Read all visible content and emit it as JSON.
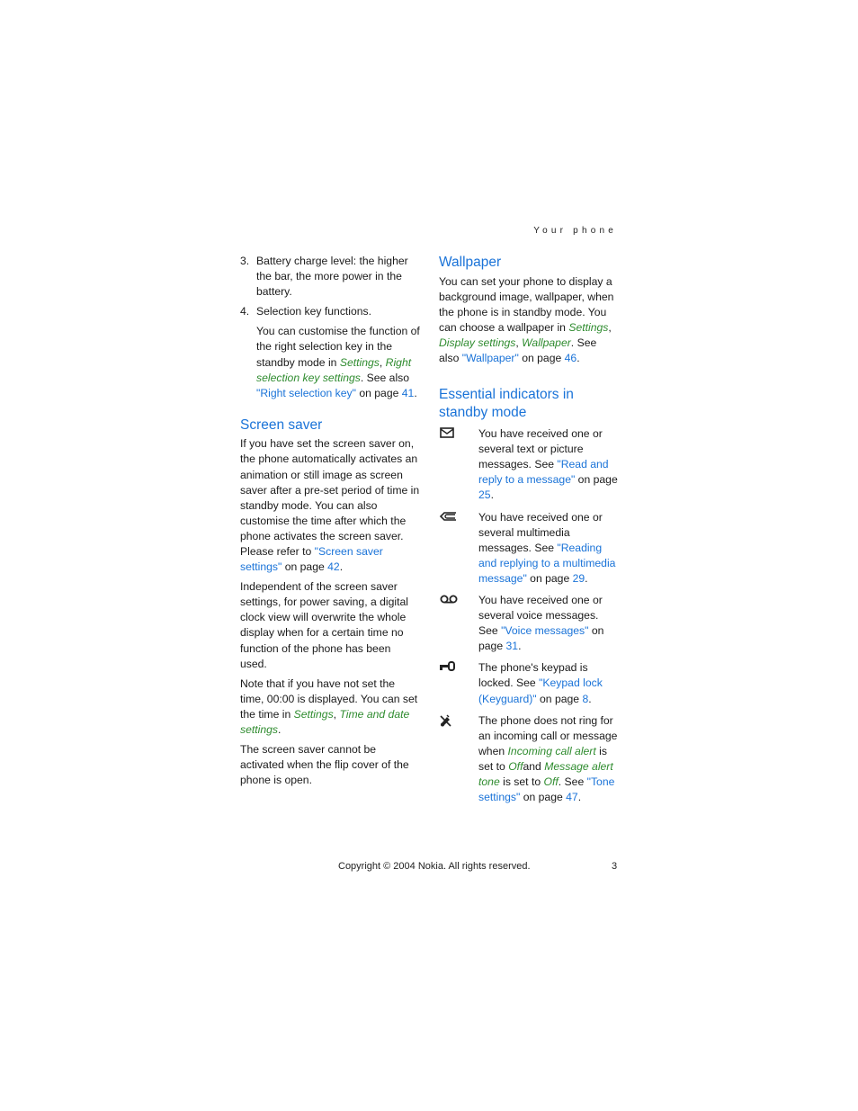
{
  "header": {
    "section": "Your phone"
  },
  "left": {
    "list": [
      {
        "num": "3.",
        "text": "Battery charge level: the higher the bar, the more power in the battery."
      },
      {
        "num": "4.",
        "text": "Selection key functions."
      }
    ],
    "customise": {
      "t1": "You can customise the function of the right selection key in the standby mode in ",
      "e1": "Settings",
      "sep1": ", ",
      "e2": "Right selection key settings",
      "t2": ". See also ",
      "link": "\"Right selection key\"",
      "t3": " on page ",
      "page": "41",
      "t4": "."
    },
    "screen_saver": {
      "title": "Screen saver",
      "p1": {
        "text": "If you have set the screen saver on, the phone automatically activates an animation or still image as screen saver after a pre-set period of time in standby mode. You can also customise the time after which the phone activates the screen saver. Please refer to ",
        "link": "\"Screen saver settings\"",
        "t2": " on page ",
        "page": "42",
        "t3": "."
      },
      "p2": "Independent of the screen saver settings, for power saving, a digital clock view will overwrite the whole display when for a certain time no function of the phone has been used.",
      "p3": {
        "text": "Note that if you have not set the time, 00:00 is displayed. You can set the time in ",
        "e1": "Settings",
        "sep": ", ",
        "e2": "Time and date settings",
        "t2": "."
      },
      "p4": "The screen saver cannot be activated when the flip cover of the phone is open."
    }
  },
  "right": {
    "wallpaper": {
      "title": "Wallpaper",
      "text": "You can set your phone to display a background image, wallpaper, when the phone is in standby mode. You can choose a wallpaper in ",
      "e1": "Settings",
      "sep1": ", ",
      "e2": "Display settings",
      "sep2": ", ",
      "e3": "Wallpaper",
      "t2": ". See also ",
      "link": "\"Wallpaper\"",
      "t3": " on page ",
      "page": "46",
      "t4": "."
    },
    "indicators": {
      "title": "Essential indicators in standby mode",
      "items": [
        {
          "icon": "envelope-icon",
          "text": "You have received one or several text or picture messages. See ",
          "link": "\"Read and reply to a message\"",
          "t2": " on page ",
          "page": "25",
          "t3": "."
        },
        {
          "icon": "multimedia-message-icon",
          "text": "You have received one or several multimedia messages. See ",
          "link": "\"Reading and replying to a multimedia message\"",
          "t2": " on page ",
          "page": "29",
          "t3": "."
        },
        {
          "icon": "voicemail-icon",
          "text": "You have received one or several voice messages. See ",
          "link": "\"Voice messages\"",
          "t2": " on page ",
          "page": "31",
          "t3": "."
        },
        {
          "icon": "key-lock-icon",
          "text": "The phone's keypad is locked. See ",
          "link": "\"Keypad lock (Keyguard)\"",
          "t2": " on page ",
          "page": "8",
          "t3": "."
        }
      ],
      "silent": {
        "icon": "silent-bell-icon",
        "t1": "The phone does not ring for an incoming call or message when ",
        "e1": "Incoming call alert",
        "t2": " is set to ",
        "e2": "Off",
        "t3": "and ",
        "e3": "Message alert tone",
        "t4": " is set to ",
        "e4": "Off",
        "t5": ". See ",
        "link": "\"Tone settings\"",
        "t6": " on page ",
        "page": "47",
        "t7": "."
      }
    }
  },
  "footer": {
    "copyright": "Copyright © 2004 Nokia. All rights reserved.",
    "page_number": "3"
  }
}
